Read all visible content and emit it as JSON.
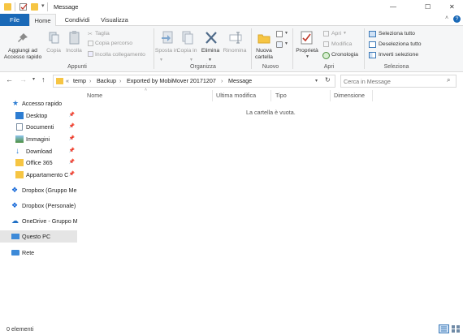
{
  "window": {
    "title": "Message",
    "minimize": "—",
    "maximize": "☐",
    "close": "✕"
  },
  "tabs": [
    {
      "label": "File"
    },
    {
      "label": "Home"
    },
    {
      "label": "Condividi"
    },
    {
      "label": "Visualizza"
    }
  ],
  "ribbon": {
    "pin_access": "Aggiungi ad Accesso rapido",
    "copy": "Copia",
    "paste": "Incolla",
    "cut": "Taglia",
    "copy_path": "Copia percorso",
    "paste_link": "Incolla collegamento",
    "group_clipboard": "Appunti",
    "move_to": "Sposta in",
    "copy_to": "Copia in",
    "delete": "Elimina",
    "rename": "Rinomina",
    "group_organize": "Organizza",
    "new_folder": "Nuova cartella",
    "group_new": "Nuovo",
    "properties": "Proprietà",
    "open": "Apri",
    "edit": "Modifica",
    "history": "Cronologia",
    "group_open": "Apri",
    "select_all": "Seleziona tutto",
    "deselect_all": "Deseleziona tutto",
    "invert_selection": "Inverti selezione",
    "group_select": "Seleziona",
    "help": "?"
  },
  "address": {
    "overflow": "«",
    "crumbs": [
      "temp",
      "Backup",
      "Exported by MobiMover 20171207",
      "Message"
    ],
    "separator": "›",
    "search_placeholder": "Cerca in Message"
  },
  "columns": [
    "Nome",
    "Ultima modifica",
    "Tipo",
    "Dimensione"
  ],
  "empty_message": "La cartella è vuota.",
  "sidebar": [
    {
      "label": "Accesso rapido"
    },
    {
      "label": "Desktop"
    },
    {
      "label": "Documenti"
    },
    {
      "label": "Immagini"
    },
    {
      "label": "Download"
    },
    {
      "label": "Office 365"
    },
    {
      "label": "Appartamento C"
    },
    {
      "label": "Dropbox (Gruppo Me"
    },
    {
      "label": "Dropbox (Personale)"
    },
    {
      "label": "OneDrive - Gruppo M"
    },
    {
      "label": "Questo PC"
    },
    {
      "label": "Rete"
    }
  ],
  "status": {
    "count": "0 elementi"
  },
  "colors": {
    "accent": "#1a69b7",
    "folder": "#f6c543",
    "selected": "#e5e5e5"
  }
}
